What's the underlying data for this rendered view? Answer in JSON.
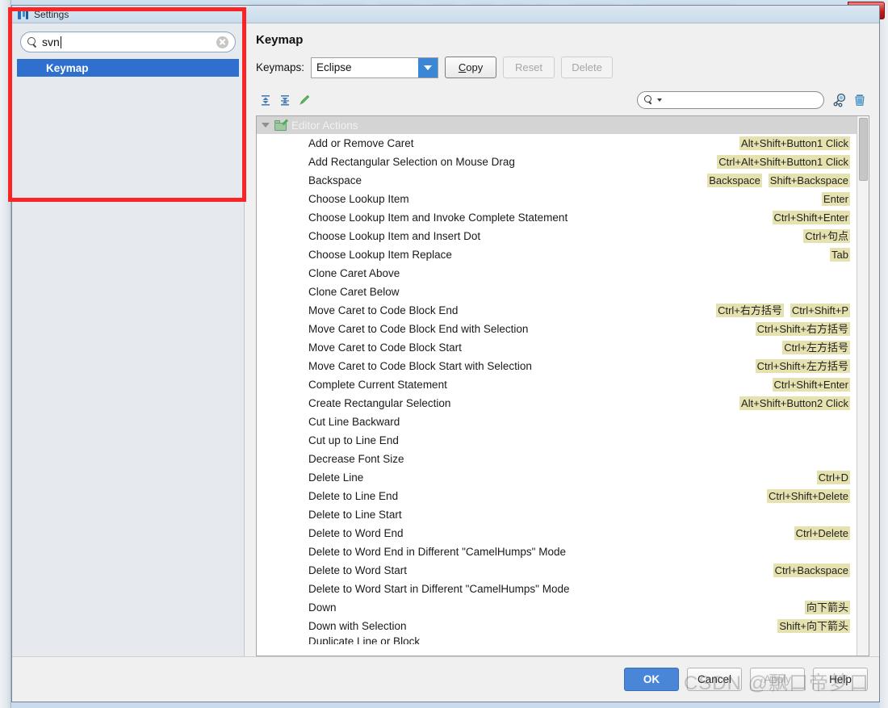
{
  "host_window": {
    "close_label": "✕"
  },
  "dialog": {
    "title": "Settings",
    "icon": "intellij-logo-icon"
  },
  "left_pane": {
    "search": {
      "value": "svn",
      "placeholder": "",
      "clear_icon": "clear-circle-icon",
      "search_icon": "search-icon"
    },
    "results": [
      {
        "label": "Keymap",
        "selected": true
      }
    ]
  },
  "right_pane": {
    "title": "Keymap",
    "keymaps_label": "Keymaps:",
    "keymap_selected": "Eclipse",
    "keymap_options": [
      "Eclipse"
    ],
    "buttons": {
      "copy": "Copy",
      "copy_mnemonic": "C",
      "reset": "Reset",
      "delete": "Delete"
    },
    "toolbar": {
      "expand_all": "expand-all-icon",
      "collapse_all": "collapse-all-icon",
      "edit_shortcut": "pencil-edit-icon",
      "filter_placeholder": "",
      "filter_value": "",
      "find_shortcut": "find-by-shortcut-icon",
      "clear_filter": "trash-delete-icon"
    },
    "tree": {
      "group": {
        "label": "Editor Actions",
        "expanded": true,
        "icon": "folder-actions-icon"
      },
      "rows": [
        {
          "name": "Add or Remove Caret",
          "shortcuts": [
            "Alt+Shift+Button1 Click"
          ]
        },
        {
          "name": "Add Rectangular Selection on Mouse Drag",
          "shortcuts": [
            "Ctrl+Alt+Shift+Button1 Click"
          ]
        },
        {
          "name": "Backspace",
          "shortcuts": [
            "Backspace",
            "Shift+Backspace"
          ]
        },
        {
          "name": "Choose Lookup Item",
          "shortcuts": [
            "Enter"
          ]
        },
        {
          "name": "Choose Lookup Item and Invoke Complete Statement",
          "shortcuts": [
            "Ctrl+Shift+Enter"
          ]
        },
        {
          "name": "Choose Lookup Item and Insert Dot",
          "shortcuts": [
            "Ctrl+句点"
          ]
        },
        {
          "name": "Choose Lookup Item Replace",
          "shortcuts": [
            "Tab"
          ]
        },
        {
          "name": "Clone Caret Above",
          "shortcuts": []
        },
        {
          "name": "Clone Caret Below",
          "shortcuts": []
        },
        {
          "name": "Move Caret to Code Block End",
          "shortcuts": [
            "Ctrl+右方括号",
            "Ctrl+Shift+P"
          ]
        },
        {
          "name": "Move Caret to Code Block End with Selection",
          "shortcuts": [
            "Ctrl+Shift+右方括号"
          ]
        },
        {
          "name": "Move Caret to Code Block Start",
          "shortcuts": [
            "Ctrl+左方括号"
          ]
        },
        {
          "name": "Move Caret to Code Block Start with Selection",
          "shortcuts": [
            "Ctrl+Shift+左方括号"
          ]
        },
        {
          "name": "Complete Current Statement",
          "shortcuts": [
            "Ctrl+Shift+Enter"
          ]
        },
        {
          "name": "Create Rectangular Selection",
          "shortcuts": [
            "Alt+Shift+Button2 Click"
          ]
        },
        {
          "name": "Cut Line Backward",
          "shortcuts": []
        },
        {
          "name": "Cut up to Line End",
          "shortcuts": []
        },
        {
          "name": "Decrease Font Size",
          "shortcuts": []
        },
        {
          "name": "Delete Line",
          "shortcuts": [
            "Ctrl+D"
          ]
        },
        {
          "name": "Delete to Line End",
          "shortcuts": [
            "Ctrl+Shift+Delete"
          ]
        },
        {
          "name": "Delete to Line Start",
          "shortcuts": []
        },
        {
          "name": "Delete to Word End",
          "shortcuts": [
            "Ctrl+Delete"
          ]
        },
        {
          "name": "Delete to Word End in Different \"CamelHumps\" Mode",
          "shortcuts": []
        },
        {
          "name": "Delete to Word Start",
          "shortcuts": [
            "Ctrl+Backspace"
          ]
        },
        {
          "name": "Delete to Word Start in Different \"CamelHumps\" Mode",
          "shortcuts": []
        },
        {
          "name": "Down",
          "shortcuts": [
            "向下箭头"
          ]
        },
        {
          "name": "Down with Selection",
          "shortcuts": [
            "Shift+向下箭头"
          ]
        },
        {
          "name": "Duplicate Line or Block",
          "shortcuts": []
        }
      ]
    }
  },
  "footer": {
    "ok": "OK",
    "cancel": "Cancel",
    "apply": "Apply",
    "help": "Help",
    "watermark": "CSDN @飘口帝梦口"
  },
  "colors": {
    "selection_blue": "#2f6fcd",
    "shortcut_highlight": "#e6e2b0",
    "ok_button": "#4a86d8",
    "annotation_red": "#fb2424",
    "combo_arrow": "#3b87d6"
  }
}
